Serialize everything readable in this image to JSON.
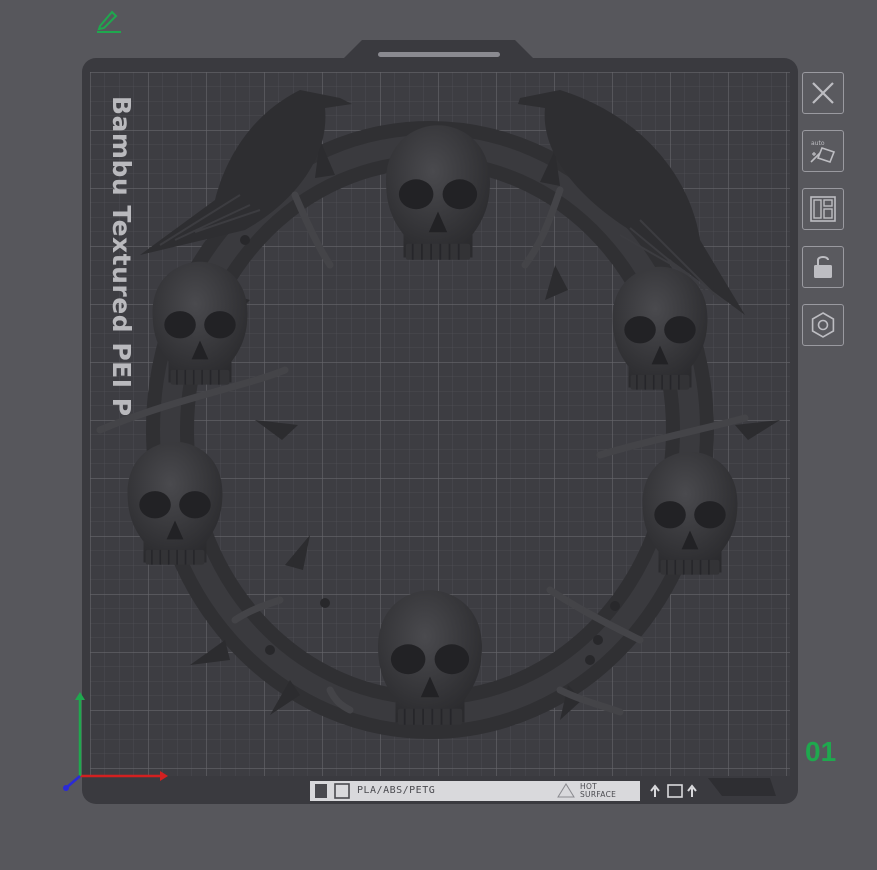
{
  "plate": {
    "label": "Bambu Textured PEI P",
    "number": "01",
    "filament_text": "PLA/ABS/PETG",
    "hot_surface_line1": "HOT",
    "hot_surface_line2": "SURFACE"
  },
  "toolbar": {
    "items": [
      {
        "name": "close-plate",
        "icon": "close-icon"
      },
      {
        "name": "auto-orient",
        "icon": "auto-orient-icon"
      },
      {
        "name": "arrange",
        "icon": "arrange-icon"
      },
      {
        "name": "lock-plate",
        "icon": "lock-icon"
      },
      {
        "name": "plate-settings",
        "icon": "settings-icon"
      }
    ]
  },
  "colors": {
    "background": "#57575c",
    "plate": "#3a3a3f",
    "grid": "#5c5c61",
    "accent_green": "#1fa84e",
    "axis_x": "#d32020",
    "axis_y": "#1fa84e",
    "axis_z": "#2a2ad8"
  },
  "model": {
    "type": "skull-wreath-with-ravens"
  }
}
